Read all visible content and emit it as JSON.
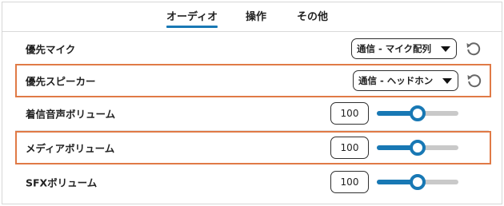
{
  "tabs": [
    {
      "label": "オーディオ",
      "active": true
    },
    {
      "label": "操作",
      "active": false
    },
    {
      "label": "その他",
      "active": false
    }
  ],
  "settings": {
    "preferred_mic": {
      "label": "優先マイク",
      "value": "通信 - マイク配列"
    },
    "preferred_speaker": {
      "label": "優先スピーカー",
      "value": "通信 - ヘッドホン"
    },
    "ringtone_volume": {
      "label": "着信音声ボリューム",
      "value": "100",
      "level": 0.5
    },
    "media_volume": {
      "label": "メディアボリューム",
      "value": "100",
      "level": 0.5
    },
    "sfx_volume": {
      "label": "SFXボリューム",
      "value": "100",
      "level": 0.5
    }
  },
  "colors": {
    "accent": "#1878b4",
    "highlight_border": "#e07a46",
    "track": "#c9c9c9"
  },
  "icons": {
    "reset": "reset-icon",
    "dropdown": "caret-down-icon"
  }
}
